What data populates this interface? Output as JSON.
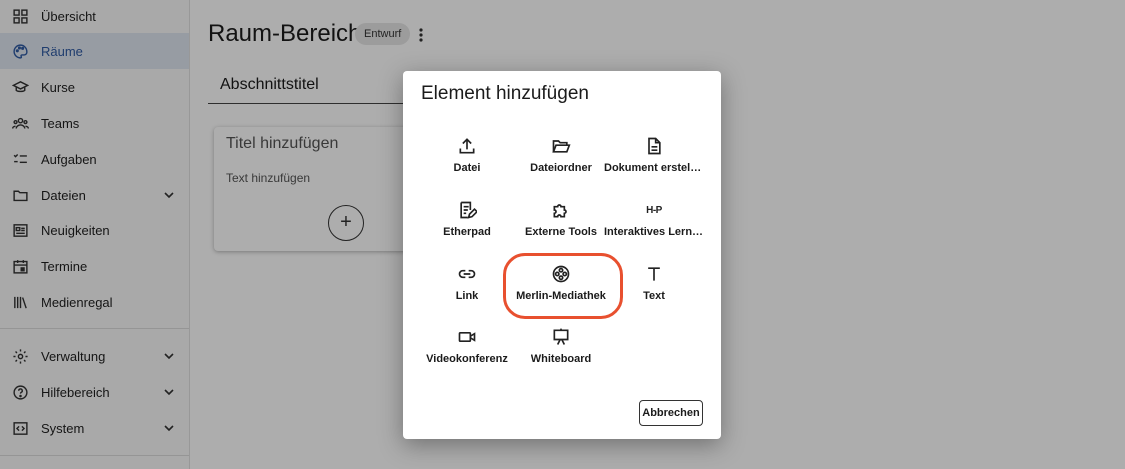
{
  "sidebar": {
    "items": [
      {
        "label": "Übersicht",
        "icon": "grid-icon"
      },
      {
        "label": "Räume",
        "icon": "palette-icon",
        "active": true
      },
      {
        "label": "Kurse",
        "icon": "school-icon"
      },
      {
        "label": "Teams",
        "icon": "people-icon"
      },
      {
        "label": "Aufgaben",
        "icon": "checklist-icon"
      },
      {
        "label": "Dateien",
        "icon": "folder-icon",
        "expandable": true
      },
      {
        "label": "Neuigkeiten",
        "icon": "newspaper-icon"
      },
      {
        "label": "Termine",
        "icon": "calendar-icon"
      },
      {
        "label": "Medienregal",
        "icon": "library-icon"
      },
      {
        "label": "Verwaltung",
        "icon": "gear-icon",
        "expandable": true
      },
      {
        "label": "Hilfebereich",
        "icon": "help-icon",
        "expandable": true
      },
      {
        "label": "System",
        "icon": "code-icon",
        "expandable": true
      }
    ]
  },
  "page": {
    "title": "Raum-Bereich",
    "badge": "Entwurf",
    "section_title": "Abschnittstitel",
    "card": {
      "title": "Titel hinzufügen",
      "text": "Text hinzufügen",
      "add_symbol": "+"
    }
  },
  "dialog": {
    "title": "Element hinzufügen",
    "items": [
      {
        "label": "Datei",
        "icon": "upload-icon"
      },
      {
        "label": "Dateiordner",
        "icon": "folder-open-icon"
      },
      {
        "label": "Dokument erstellen",
        "icon": "document-icon"
      },
      {
        "label": "Etherpad",
        "icon": "etherpad-icon"
      },
      {
        "label": "Externe Tools",
        "icon": "puzzle-icon"
      },
      {
        "label": "Interaktives Lernelement",
        "icon": "h5p-icon",
        "icon_text": "H-P"
      },
      {
        "label": "Link",
        "icon": "link-icon"
      },
      {
        "label": "Merlin-Mediathek",
        "icon": "film-reel-icon",
        "highlighted": true
      },
      {
        "label": "Text",
        "icon": "text-icon"
      },
      {
        "label": "Videokonferenz",
        "icon": "video-camera-icon"
      },
      {
        "label": "Whiteboard",
        "icon": "presentation-board-icon"
      }
    ],
    "cancel_label": "Abbrechen"
  },
  "colors": {
    "accent": "#2f5aa3",
    "active_bg": "#dfe6f1",
    "highlight": "#e8502f",
    "scrim": "rgba(0,0,0,0.32)"
  }
}
